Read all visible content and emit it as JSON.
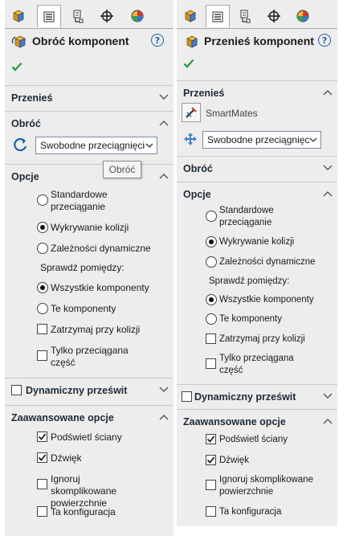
{
  "left": {
    "tabs": [
      "featuremanager-icon",
      "propertymanager-icon",
      "configurationmanager-icon",
      "dimxpert-icon",
      "display-manager-icon"
    ],
    "title": "Obróć komponent",
    "help": "?",
    "sections": {
      "move": "Przenieś",
      "rotate": "Obróć",
      "options": "Opcje",
      "dynamic_clearance": "Dynamiczny prześwit",
      "advanced": "Zaawansowane opcje"
    },
    "rotate_select": "Swobodne przeciągnięcie",
    "tooltip": "Obróć",
    "options": {
      "standard": "Standardowe przeciąganie",
      "collision": "Wykrywanie kolizji",
      "dynamic": "Zależności dynamiczne",
      "check_between": "Sprawdź pomiędzy:",
      "all_components": "Wszystkie komponenty",
      "these_components": "Te komponenty",
      "stop_at_collision": "Zatrzymaj przy kolizji",
      "dragged_only": "Tylko przeciągana część"
    },
    "advanced": {
      "highlight": "Podświetl ściany",
      "sound": "Dźwięk",
      "ignore": "Ignoruj skomplikowane powierzchnie",
      "this_config": "Ta konfiguracja"
    }
  },
  "right": {
    "tabs": [
      "featuremanager-icon",
      "propertymanager-icon",
      "configurationmanager-icon",
      "dimxpert-icon",
      "display-manager-icon"
    ],
    "title": "Przenieś komponent",
    "help": "?",
    "sections": {
      "move": "Przenieś",
      "rotate": "Obróć",
      "options": "Opcje",
      "dynamic_clearance": "Dynamiczny prześwit",
      "advanced": "Zaawansowane opcje"
    },
    "smartmates": "SmartMates",
    "move_select": "Swobodne przeciągnięcie",
    "options": {
      "standard": "Standardowe przeciąganie",
      "collision": "Wykrywanie kolizji",
      "dynamic": "Zależności dynamiczne",
      "check_between": "Sprawdź pomiędzy:",
      "all_components": "Wszystkie komponenty",
      "these_components": "Te komponenty",
      "stop_at_collision": "Zatrzymaj przy kolizji",
      "dragged_only": "Tylko przeciągana część"
    },
    "advanced": {
      "highlight": "Podświetl ściany",
      "sound": "Dźwięk",
      "ignore": "Ignoruj skomplikowane powierzchnie",
      "this_config": "Ta konfiguracja"
    }
  },
  "colors": {
    "check_green": "#2e9e3e",
    "help_blue": "#1f5fa8",
    "header_text": "#1f2a36",
    "panel_bg": "#ededed"
  }
}
